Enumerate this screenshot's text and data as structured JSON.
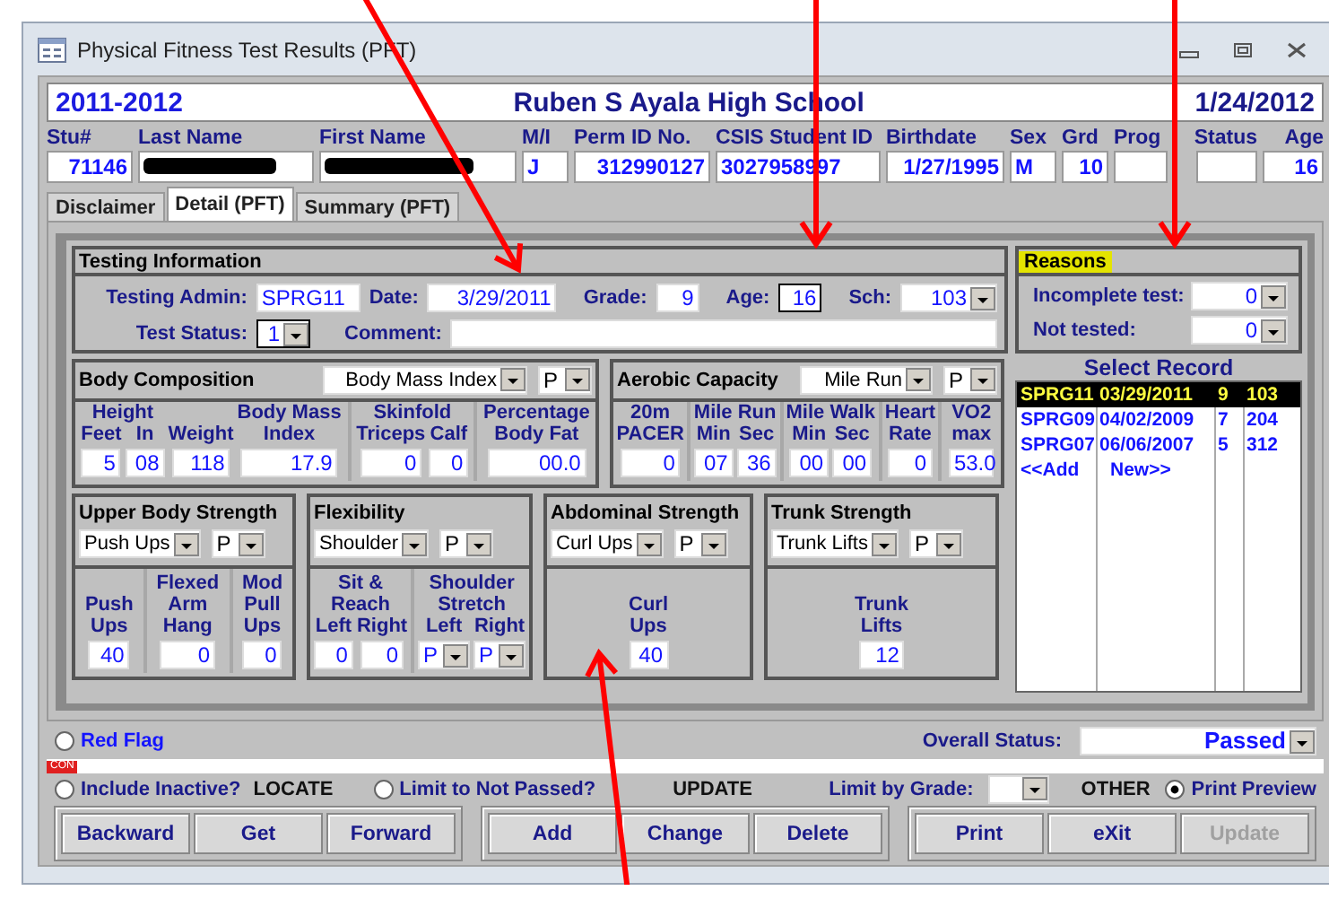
{
  "window": {
    "title": "Physical Fitness Test Results (PFT)"
  },
  "header": {
    "school_year": "2011-2012",
    "school": "Ruben S Ayala High School",
    "date": "1/24/2012"
  },
  "student_fields": [
    {
      "label": "Stu#",
      "value": "71146",
      "kind": "text"
    },
    {
      "label": "Last Name",
      "kind": "redacted"
    },
    {
      "label": "First Name",
      "kind": "redacted"
    },
    {
      "label": "M/I",
      "value": "J",
      "kind": "text"
    },
    {
      "label": "Perm ID No.",
      "value": "312990127",
      "kind": "text"
    },
    {
      "label": "CSIS Student ID",
      "value": "3027958997",
      "kind": "text"
    },
    {
      "label": "Birthdate",
      "value": "1/27/1995",
      "kind": "text"
    },
    {
      "label": "Sex",
      "value": "M",
      "kind": "text"
    },
    {
      "label": "Grd",
      "value": "10",
      "kind": "text"
    },
    {
      "label": "Prog",
      "kind": "text"
    },
    {
      "label": "Status",
      "kind": "text"
    },
    {
      "label": "Age",
      "value": "16",
      "kind": "text"
    }
  ],
  "tabs": [
    {
      "label": "Disclaimer",
      "selected": false
    },
    {
      "label": "Detail (PFT)",
      "selected": true
    },
    {
      "label": "Summary (PFT)",
      "selected": false
    }
  ],
  "testing_information": {
    "title": "Testing Information",
    "testing_admin": {
      "label": "Testing Admin:",
      "value": "SPRG11"
    },
    "date": {
      "label": "Date:",
      "value": "3/29/2011"
    },
    "grade": {
      "label": "Grade:",
      "value": "9"
    },
    "age": {
      "label": "Age:",
      "value": "16",
      "focused": true
    },
    "school": {
      "label": "Sch:",
      "value": "103"
    },
    "test_status": {
      "label": "Test Status:",
      "value": "1",
      "focused": true
    },
    "comment": {
      "label": "Comment:"
    }
  },
  "fitness_rows": [
    [
      {
        "title": "Body Composition",
        "test": "Body Mass Index",
        "result": "P",
        "panels": [
          {
            "groups": [
              {
                "heading": "Height",
                "fields": [
                  {
                    "label": "Feet",
                    "value": "5"
                  },
                  {
                    "label": "In",
                    "value": "08"
                  }
                ]
              },
              {
                "fields": [
                  {
                    "label": "Weight",
                    "value": "118"
                  }
                ]
              },
              {
                "fields": [
                  {
                    "label": "Body Mass\nIndex",
                    "value": "17.9"
                  }
                ]
              }
            ]
          },
          {
            "groups": [
              {
                "heading": "Skinfold",
                "fields": [
                  {
                    "label": "Triceps",
                    "value": "0"
                  },
                  {
                    "label": "Calf",
                    "value": "0"
                  }
                ]
              }
            ]
          },
          {
            "groups": [
              {
                "fields": [
                  {
                    "label": "Percentage\nBody Fat",
                    "value": "00.0"
                  }
                ]
              }
            ]
          }
        ]
      },
      {
        "title": "Aerobic Capacity",
        "test": "Mile Run",
        "result": "P",
        "panels": [
          {
            "groups": [
              {
                "fields": [
                  {
                    "label": "20m\nPACER",
                    "value": "0"
                  }
                ]
              }
            ]
          },
          {
            "groups": [
              {
                "heading": "Mile Run",
                "fields": [
                  {
                    "label": "Min",
                    "value": "07"
                  },
                  {
                    "label": "Sec",
                    "value": "36"
                  }
                ]
              }
            ]
          },
          {
            "groups": [
              {
                "heading": "Mile Walk",
                "fields": [
                  {
                    "label": "Min",
                    "value": "00"
                  },
                  {
                    "label": "Sec",
                    "value": "00"
                  }
                ]
              }
            ]
          },
          {
            "groups": [
              {
                "fields": [
                  {
                    "label": "Heart\nRate",
                    "value": "0"
                  }
                ]
              }
            ]
          },
          {
            "groups": [
              {
                "fields": [
                  {
                    "label": "VO2\nmax",
                    "value": "53.0"
                  }
                ]
              }
            ]
          }
        ]
      }
    ],
    [
      {
        "title": "Upper Body Strength",
        "test": "Push Ups",
        "result": "P",
        "panels": [
          {
            "groups": [
              {
                "fields": [
                  {
                    "label": "Push\nUps",
                    "value": "40"
                  }
                ]
              }
            ]
          },
          {
            "groups": [
              {
                "fields": [
                  {
                    "label": "Flexed\nArm\nHang",
                    "value": "0"
                  }
                ]
              }
            ]
          },
          {
            "groups": [
              {
                "fields": [
                  {
                    "label": "Mod\nPull\nUps",
                    "value": "0"
                  }
                ]
              }
            ]
          }
        ]
      },
      {
        "title": "Flexibility",
        "test": "Shoulder",
        "result": "P",
        "panels": [
          {
            "groups": [
              {
                "heading": "Sit &\nReach",
                "fields": [
                  {
                    "label": "Left",
                    "value": "0",
                    "kind": "text"
                  },
                  {
                    "label": "Right",
                    "value": "0",
                    "kind": "text"
                  }
                ]
              }
            ]
          },
          {
            "groups": [
              {
                "heading": "Shoulder\nStretch",
                "fields": [
                  {
                    "label": "Left",
                    "value": "P",
                    "kind": "dropdown"
                  },
                  {
                    "label": "Right",
                    "value": "P",
                    "kind": "dropdown"
                  }
                ]
              }
            ]
          }
        ]
      },
      {
        "title": "Abdominal Strength",
        "test": "Curl Ups",
        "result": "P",
        "panels": [
          {
            "groups": [
              {
                "fields": [
                  {
                    "label": "Curl\nUps",
                    "value": "40"
                  }
                ]
              }
            ]
          }
        ]
      },
      {
        "title": "Trunk Strength",
        "test": "Trunk Lifts",
        "result": "P",
        "panels": [
          {
            "groups": [
              {
                "fields": [
                  {
                    "label": "Trunk\nLifts",
                    "value": "12"
                  }
                ]
              }
            ]
          }
        ]
      }
    ]
  ],
  "reasons": {
    "title": "Reasons",
    "fields": [
      {
        "label": "Incomplete test:",
        "value": "0"
      },
      {
        "label": "Not tested:",
        "value": "0"
      }
    ]
  },
  "select_record": {
    "title": "Select Record",
    "rows": [
      {
        "cells": [
          "SPRG11",
          "03/29/2011",
          "9",
          "103"
        ],
        "selected": true
      },
      {
        "cells": [
          "SPRG09",
          "04/02/2009",
          "7",
          "204"
        ],
        "selected": false
      },
      {
        "cells": [
          "SPRG07",
          "06/06/2007",
          "5",
          "312"
        ],
        "selected": false
      }
    ],
    "add_row": [
      "<<Add",
      "New>>"
    ]
  },
  "red_flag": {
    "label": "Red Flag",
    "checked": false
  },
  "overall_status": {
    "label": "Overall Status:",
    "value": "Passed"
  },
  "con_badge": "CON",
  "include_inactive": {
    "label": "Include Inactive?",
    "checked": false
  },
  "locate_label": "LOCATE",
  "limit_not_passed": {
    "label": "Limit to Not Passed?",
    "checked": false
  },
  "update_label": "UPDATE",
  "limit_by_grade": {
    "label": "Limit by Grade:"
  },
  "other_label": "OTHER",
  "print_preview": {
    "label": "Print Preview",
    "checked": true
  },
  "button_groups": [
    [
      {
        "label": "Backward",
        "disabled": false
      },
      {
        "label": "Get",
        "disabled": false
      },
      {
        "label": "Forward",
        "disabled": false
      }
    ],
    [
      {
        "label": "Add",
        "disabled": false
      },
      {
        "label": "Change",
        "disabled": false
      },
      {
        "label": "Delete",
        "disabled": false
      }
    ],
    [
      {
        "label": "Print",
        "disabled": false
      },
      {
        "label": "eXit",
        "disabled": false
      },
      {
        "label": "Update",
        "disabled": true
      }
    ]
  ]
}
